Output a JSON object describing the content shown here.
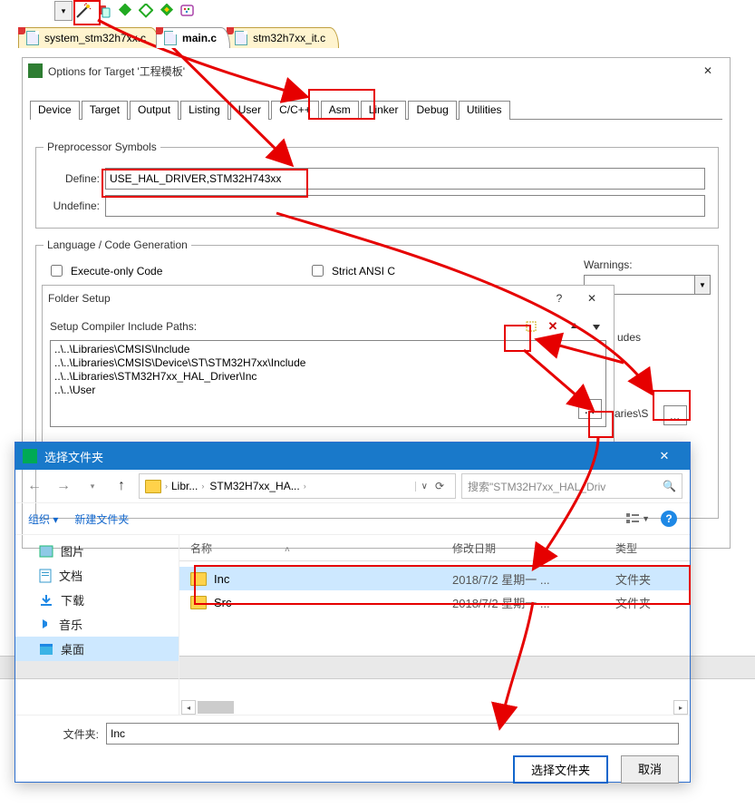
{
  "toolbar": {},
  "file_tabs": [
    "system_stm32h7xx.c",
    "main.c",
    "stm32h7xx_it.c"
  ],
  "options": {
    "title": "Options for Target '工程模板'",
    "tabs": [
      "Device",
      "Target",
      "Output",
      "Listing",
      "User",
      "C/C++",
      "Asm",
      "Linker",
      "Debug",
      "Utilities"
    ],
    "preproc_caption": "Preprocessor Symbols",
    "define_label": "Define:",
    "define_value": "USE_HAL_DRIVER,STM32H743xx",
    "undefine_label": "Undefine:",
    "lang_caption": "Language / Code Generation",
    "exec_only": "Execute-only Code",
    "strict_ansi": "Strict ANSI C",
    "warnings_label": "Warnings:",
    "includes_label_tail": "udes",
    "includes_value_tail": "aries\\S"
  },
  "folder_setup": {
    "title": "Folder Setup",
    "prompt": "Setup Compiler Include Paths:",
    "paths": [
      "..\\..\\Libraries\\CMSIS\\Include",
      "..\\..\\Libraries\\CMSIS\\Device\\ST\\STM32H7xx\\Include",
      "..\\..\\Libraries\\STM32H7xx_HAL_Driver\\Inc",
      "..\\..\\User"
    ]
  },
  "explorer": {
    "title": "选择文件夹",
    "breadcrumbs": [
      "Libr...",
      "STM32H7xx_HA..."
    ],
    "search_placeholder": "搜索\"STM32H7xx_HAL_Driv",
    "organize": "组织",
    "new_folder": "新建文件夹",
    "sidebar": [
      "图片",
      "文档",
      "下载",
      "音乐",
      "桌面"
    ],
    "columns": {
      "name": "名称",
      "date": "修改日期",
      "type": "类型"
    },
    "rows": [
      {
        "name": "Inc",
        "date": "2018/7/2 星期一 ...",
        "type": "文件夹"
      },
      {
        "name": "Src",
        "date": "2018/7/2 星期一 ...",
        "type": "文件夹"
      }
    ],
    "folder_label": "文件夹:",
    "folder_value": "Inc",
    "select": "选择文件夹",
    "cancel": "取消"
  }
}
